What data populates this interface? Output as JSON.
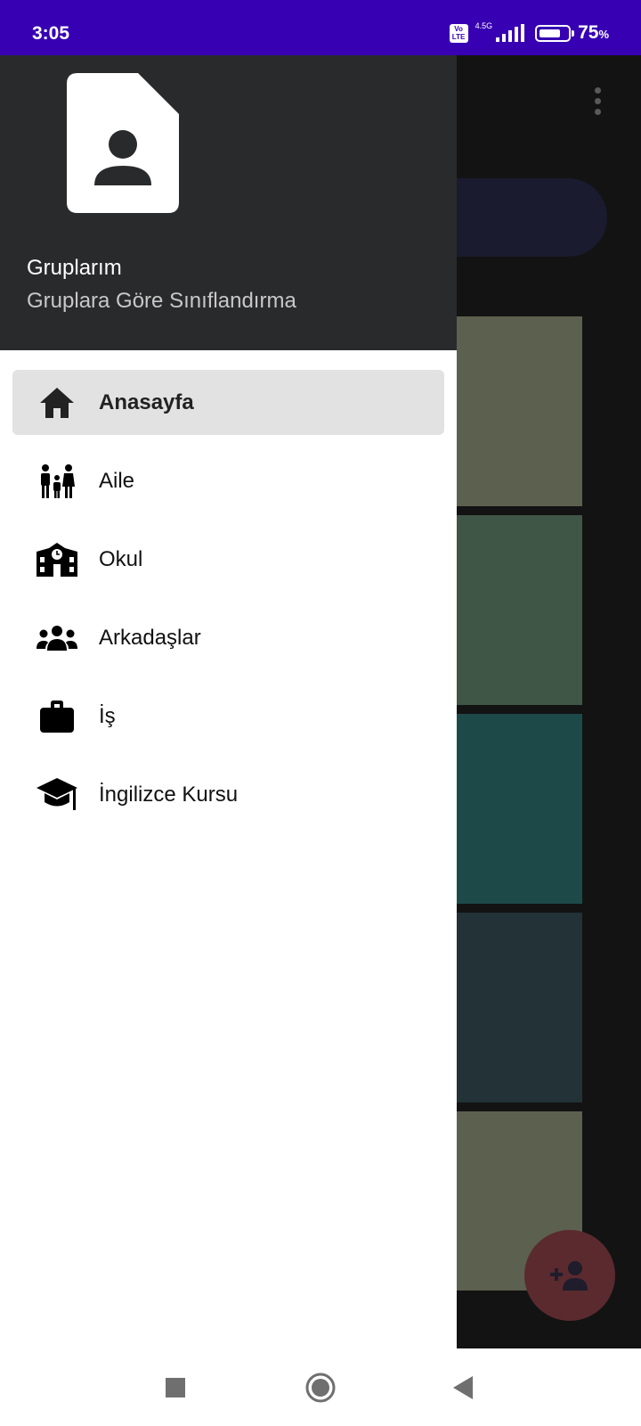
{
  "status_bar": {
    "time": "3:05",
    "volte_top": "Vo",
    "volte_bottom": "LTE",
    "network": "4.5G",
    "battery_percent": "75",
    "battery_unit": "%",
    "battery_level": 0.75
  },
  "drawer": {
    "header": {
      "title": "Gruplarım",
      "subtitle": "Gruplara Göre Sınıflandırma",
      "avatar_icon": "contact-file-icon"
    },
    "items": [
      {
        "label": "Anasayfa",
        "icon": "home-icon",
        "active": true
      },
      {
        "label": "Aile",
        "icon": "family-icon",
        "active": false
      },
      {
        "label": "Okul",
        "icon": "school-icon",
        "active": false
      },
      {
        "label": "Arkadaşlar",
        "icon": "people-icon",
        "active": false
      },
      {
        "label": "İş",
        "icon": "briefcase-icon",
        "active": false
      },
      {
        "label": "İngilizce Kursu",
        "icon": "graduation-cap-icon",
        "active": false
      }
    ]
  },
  "background_app": {
    "fab_icon": "add-person-icon",
    "overflow_icon": "more-vert-icon",
    "card_colors": [
      "#5c604e",
      "#3f5545",
      "#1d4a49",
      "#223236",
      "#5c604e"
    ]
  },
  "colors": {
    "status_bar": "#3700b3",
    "drawer_header": "#292a2c",
    "active_item": "#e2e2e2",
    "fab": "#5a2a2f"
  }
}
